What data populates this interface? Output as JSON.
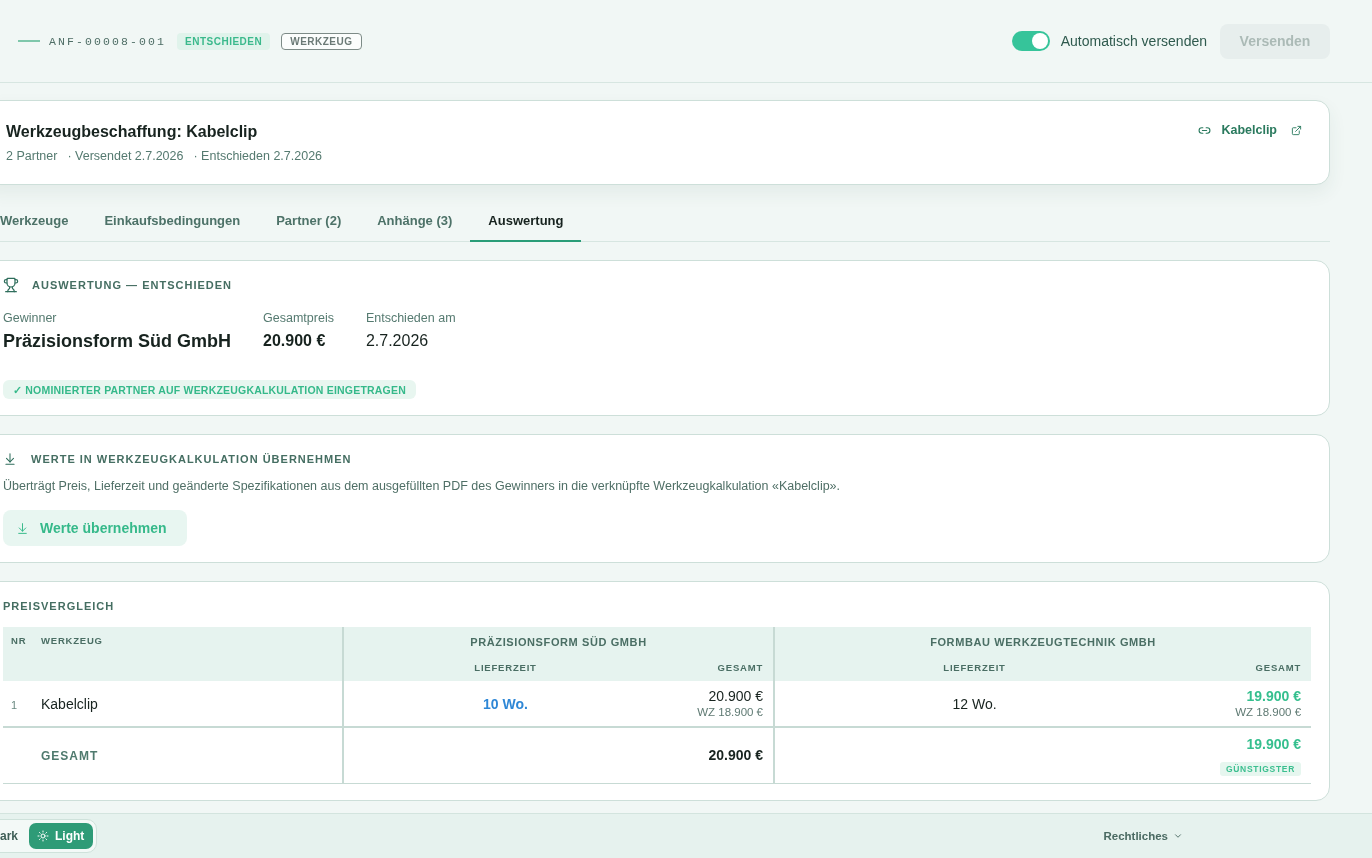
{
  "header": {
    "request_id": "ANF-00008-001",
    "badges": [
      {
        "label": "ENTSCHIEDEN",
        "kind": "status"
      },
      {
        "label": "WERKZEUG",
        "kind": "outline"
      }
    ],
    "auto_send": {
      "label": "Automatisch versenden",
      "on": true
    },
    "send_button": {
      "label": "Versenden",
      "disabled": true
    }
  },
  "request": {
    "title": "Werkzeugbeschaffung: Kabelclip",
    "meta": [
      "2 Partner",
      "· Versendet 2.7.2026",
      "· Entschieden 2.7.2026"
    ],
    "link": "Kabelclip"
  },
  "tabs": [
    {
      "label": "Werkzeuge",
      "selected": false
    },
    {
      "label": "Einkaufsbedingungen",
      "selected": false
    },
    {
      "label": "Partner (2)",
      "selected": false
    },
    {
      "label": "Anhänge (3)",
      "selected": false
    },
    {
      "label": "Auswertung",
      "selected": true
    }
  ],
  "evaluation": {
    "heading": "AUSWERTUNG — ENTSCHIEDEN",
    "facts": [
      {
        "label": "Gewinner",
        "value": "Präzisionsform Süd GmbH",
        "kind": "winner"
      },
      {
        "label": "Gesamtpreis",
        "value": "20.900 €",
        "kind": "price"
      },
      {
        "label": "Entschieden am",
        "value": "2.7.2026",
        "kind": "date"
      }
    ],
    "confirmation": "✓ NOMINIERTER PARTNER AUF WERKZEUGKALKULATION EINGETRAGEN"
  },
  "transfer": {
    "heading": "WERTE IN WERKZEUGKALKULATION ÜBERNEHMEN",
    "description": "Überträgt Preis, Lieferzeit und geänderte Spezifikationen aus dem ausgefüllten PDF des Gewinners in die verknüpfte Werkzeugkalkulation «Kabelclip».",
    "button": "Werte übernehmen"
  },
  "price_comparison": {
    "heading": "PREISVERGLEICH",
    "columns": {
      "nr": "NR",
      "tool": "WERKZEUG"
    },
    "suppliers": [
      {
        "name": "PRÄZISIONSFORM SÜD GMBH",
        "lead_time_header": "LIEFERZEIT",
        "total_header": "GESAMT"
      },
      {
        "name": "FORMBAU WERKZEUGTECHNIK GMBH",
        "lead_time_header": "LIEFERZEIT",
        "total_header": "GESAMT"
      }
    ],
    "rows": [
      {
        "nr": "1",
        "tool": "Kabelclip",
        "offers": [
          {
            "lead_time": "10 Wo.",
            "fastest": true,
            "total": "20.900 €",
            "cheapest": false,
            "tooling": "WZ 18.900 €"
          },
          {
            "lead_time": "12 Wo.",
            "fastest": false,
            "total": "19.900 €",
            "cheapest": true,
            "tooling": "WZ 18.900 €"
          }
        ]
      }
    ],
    "totals": {
      "label": "GESAMT",
      "values": [
        {
          "value": "20.900 €",
          "cheapest": false
        },
        {
          "value": "19.900 €",
          "cheapest": true,
          "badge": "GÜNSTIGSTER"
        }
      ]
    }
  },
  "footer": {
    "theme_options": [
      {
        "label": "ark",
        "kind": "dark",
        "selected": false
      },
      {
        "label": "Light",
        "kind": "light",
        "selected": true
      }
    ],
    "legal_menu": "Rechtliches"
  }
}
